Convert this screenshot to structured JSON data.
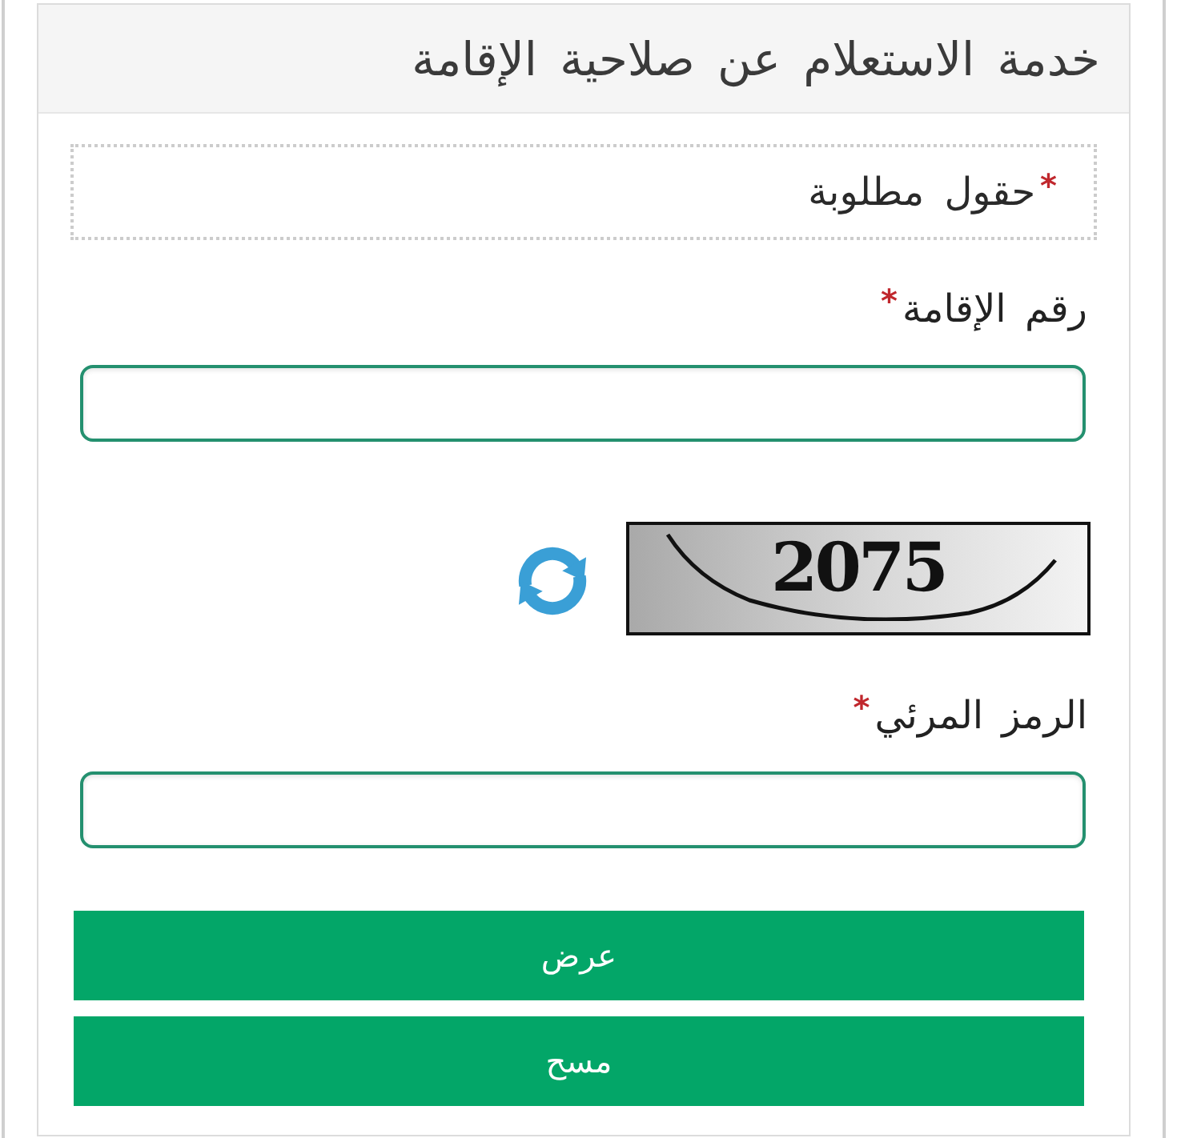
{
  "panel": {
    "title": "خدمة الاستعلام عن صلاحية الإقامة"
  },
  "required_note": {
    "marker": "*",
    "text": "حقول مطلوبة"
  },
  "fields": [
    {
      "kind": "text",
      "label": "رقم الإقامة",
      "marker": "*"
    },
    {
      "kind": "captcha",
      "label": "الرمز المرئي",
      "marker": "*",
      "code": "2075"
    }
  ],
  "buttons": [
    {
      "label": "عرض"
    },
    {
      "label": "مسح"
    }
  ]
}
